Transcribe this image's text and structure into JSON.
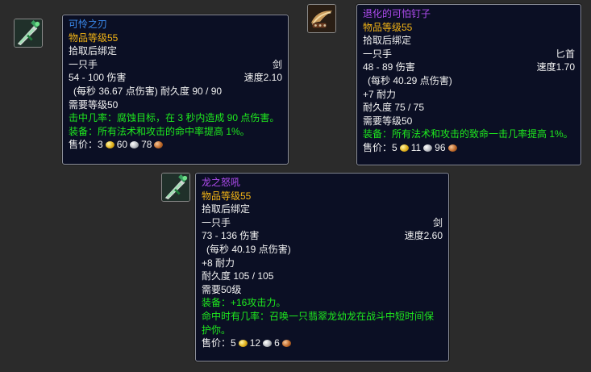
{
  "tooltips": [
    {
      "name": "可怜之刃",
      "item_level": "物品等级55",
      "bind": "拾取后绑定",
      "slot": "一只手",
      "type": "剑",
      "damage": "54 - 100 伤害",
      "speed": "速度2.10",
      "dps_durability": "(每秒 36.67 点伤害) 耐久度 90 / 90",
      "requires": "需要等级50",
      "effect1": "击中几率：腐蚀目标，在 3 秒内造成 90 点伤害。",
      "effect2": "装备：所有法术和攻击的命中率提高 1%。",
      "sell_label": "售价：",
      "gold": "3",
      "silver": "60",
      "copper": "78"
    },
    {
      "name": "退化的可怕钉子",
      "item_level": "物品等级55",
      "bind": "拾取后绑定",
      "slot": "一只手",
      "type": "匕首",
      "damage": "48 - 89 伤害",
      "speed": "速度1.70",
      "dps": "(每秒 40.29 点伤害)",
      "stat": "+7 耐力",
      "durability": "耐久度 75 / 75",
      "requires": "需要等级50",
      "effect1": "装备：所有法术和攻击的致命一击几率提高 1%。",
      "sell_label": "售价：",
      "gold": "5",
      "silver": "11",
      "copper": "96"
    },
    {
      "name": "龙之怒吼",
      "item_level": "物品等级55",
      "bind": "拾取后绑定",
      "slot": "一只手",
      "type": "剑",
      "damage": "73 - 136 伤害",
      "speed": "速度2.60",
      "dps": "(每秒 40.19 点伤害)",
      "stat": "+8 耐力",
      "durability": "耐久度 105 / 105",
      "requires": "需要50级",
      "effect1": "装备：+16攻击力。",
      "effect2": "命中时有几率：召唤一只翡翠龙幼龙在战斗中短时间保护你。",
      "sell_label": "售价：",
      "gold": "5",
      "silver": "12",
      "copper": "6"
    }
  ],
  "icons": {
    "icon1": "green-sword-icon",
    "icon2": "dagger-icon",
    "icon3": "green-sword-icon"
  },
  "colors": {
    "tooltip_bg": "#0b0f24",
    "blue_quality": "#3b8cf0",
    "epic_quality": "#b04cf0",
    "item_level": "#f3b415",
    "green_effect": "#1eea1e"
  }
}
